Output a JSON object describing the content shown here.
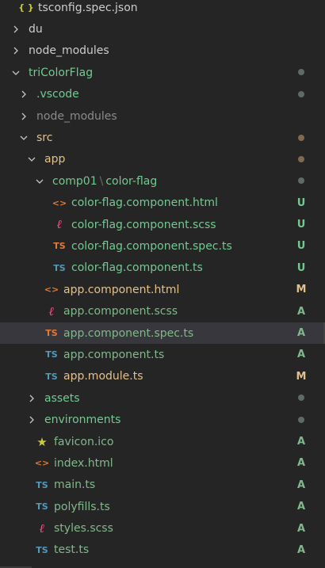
{
  "colors": {
    "background": "#252526",
    "default_text": "#cccccc",
    "folder_dim": "#8b8b8b",
    "untracked_green": "#73c991",
    "modified_yellow": "#e2c08d",
    "added_green": "#81b88b",
    "selected_row": "#37373d",
    "dot_gray": "#5d6b63",
    "dot_brown": "#7d6a4f"
  },
  "tree": [
    {
      "label": "tsconfig.spec.json",
      "type": "file",
      "icon": "json-braces-icon",
      "glyph": "{ }",
      "icon_color": "#cbcb41",
      "text_color": "#cccccc",
      "depth": 1,
      "status": ""
    },
    {
      "label": "du",
      "type": "folder",
      "expanded": false,
      "depth": 1,
      "text_color": "#cccccc",
      "status": ""
    },
    {
      "label": "node_modules",
      "type": "folder",
      "expanded": false,
      "depth": 1,
      "text_color": "#cccccc",
      "status": ""
    },
    {
      "label": "triColorFlag",
      "type": "folder",
      "expanded": true,
      "depth": 1,
      "text_color": "#73c991",
      "status": "dot",
      "dot_color": "#5d6b63"
    },
    {
      "label": ".vscode",
      "type": "folder",
      "expanded": false,
      "depth": 2,
      "text_color": "#73c991",
      "status": "dot",
      "dot_color": "#5d6b63"
    },
    {
      "label": "node_modules",
      "type": "folder",
      "expanded": false,
      "depth": 2,
      "text_color": "#8b8b8b",
      "status": ""
    },
    {
      "label": "src",
      "type": "folder",
      "expanded": true,
      "depth": 2,
      "text_color": "#e2c08d",
      "status": "dot",
      "dot_color": "#7d6a4f"
    },
    {
      "label": "app",
      "type": "folder",
      "expanded": true,
      "depth": 3,
      "text_color": "#e2c08d",
      "status": "dot",
      "dot_color": "#7d6a4f"
    },
    {
      "label": "comp01",
      "suffix": "color-flag",
      "type": "folder",
      "expanded": true,
      "depth": 4,
      "text_color": "#73c991",
      "status": "dot",
      "dot_color": "#5d6b63"
    },
    {
      "label": "color-flag.component.html",
      "type": "file",
      "icon": "html-code-icon",
      "glyph": "<>",
      "icon_color": "#e37933",
      "text_color": "#73c991",
      "depth": 5,
      "status": "U",
      "status_color": "#73c991"
    },
    {
      "label": "color-flag.component.scss",
      "type": "file",
      "icon": "sass-icon",
      "glyph": "ℓ",
      "icon_color": "#f55385",
      "text_color": "#73c991",
      "depth": 5,
      "status": "U",
      "status_color": "#73c991"
    },
    {
      "label": "color-flag.component.spec.ts",
      "type": "file",
      "icon": "typescript-spec-icon",
      "glyph": "TS",
      "icon_color": "#e37933",
      "text_color": "#73c991",
      "depth": 5,
      "status": "U",
      "status_color": "#73c991"
    },
    {
      "label": "color-flag.component.ts",
      "type": "file",
      "icon": "typescript-icon",
      "glyph": "TS",
      "icon_color": "#519aba",
      "text_color": "#73c991",
      "depth": 5,
      "status": "U",
      "status_color": "#73c991"
    },
    {
      "label": "app.component.html",
      "type": "file",
      "icon": "html-code-icon",
      "glyph": "<>",
      "icon_color": "#e37933",
      "text_color": "#e2c08d",
      "depth": 4,
      "status": "M",
      "status_color": "#e2c08d"
    },
    {
      "label": "app.component.scss",
      "type": "file",
      "icon": "sass-icon",
      "glyph": "ℓ",
      "icon_color": "#f55385",
      "text_color": "#81b88b",
      "depth": 4,
      "status": "A",
      "status_color": "#81b88b"
    },
    {
      "label": "app.component.spec.ts",
      "type": "file",
      "icon": "typescript-spec-icon",
      "glyph": "TS",
      "icon_color": "#e37933",
      "text_color": "#81b88b",
      "depth": 4,
      "status": "A",
      "status_color": "#81b88b",
      "selected": true
    },
    {
      "label": "app.component.ts",
      "type": "file",
      "icon": "typescript-icon",
      "glyph": "TS",
      "icon_color": "#519aba",
      "text_color": "#81b88b",
      "depth": 4,
      "status": "A",
      "status_color": "#81b88b"
    },
    {
      "label": "app.module.ts",
      "type": "file",
      "icon": "typescript-icon",
      "glyph": "TS",
      "icon_color": "#519aba",
      "text_color": "#e2c08d",
      "depth": 4,
      "status": "M",
      "status_color": "#e2c08d"
    },
    {
      "label": "assets",
      "type": "folder",
      "expanded": false,
      "depth": 3,
      "text_color": "#73c991",
      "status": "dot",
      "dot_color": "#5d6b63"
    },
    {
      "label": "environments",
      "type": "folder",
      "expanded": false,
      "depth": 3,
      "text_color": "#73c991",
      "status": "dot",
      "dot_color": "#5d6b63"
    },
    {
      "label": "favicon.ico",
      "type": "file",
      "icon": "star-icon",
      "glyph": "★",
      "icon_color": "#cbcb41",
      "text_color": "#81b88b",
      "depth": 3,
      "status": "A",
      "status_color": "#81b88b"
    },
    {
      "label": "index.html",
      "type": "file",
      "icon": "html-code-icon",
      "glyph": "<>",
      "icon_color": "#e37933",
      "text_color": "#81b88b",
      "depth": 3,
      "status": "A",
      "status_color": "#81b88b"
    },
    {
      "label": "main.ts",
      "type": "file",
      "icon": "typescript-icon",
      "glyph": "TS",
      "icon_color": "#519aba",
      "text_color": "#81b88b",
      "depth": 3,
      "status": "A",
      "status_color": "#81b88b"
    },
    {
      "label": "polyfills.ts",
      "type": "file",
      "icon": "typescript-icon",
      "glyph": "TS",
      "icon_color": "#519aba",
      "text_color": "#81b88b",
      "depth": 3,
      "status": "A",
      "status_color": "#81b88b"
    },
    {
      "label": "styles.scss",
      "type": "file",
      "icon": "sass-icon",
      "glyph": "ℓ",
      "icon_color": "#f55385",
      "text_color": "#81b88b",
      "depth": 3,
      "status": "A",
      "status_color": "#81b88b"
    },
    {
      "label": "test.ts",
      "type": "file",
      "icon": "typescript-icon",
      "glyph": "TS",
      "icon_color": "#519aba",
      "text_color": "#81b88b",
      "depth": 3,
      "status": "A",
      "status_color": "#81b88b"
    }
  ]
}
